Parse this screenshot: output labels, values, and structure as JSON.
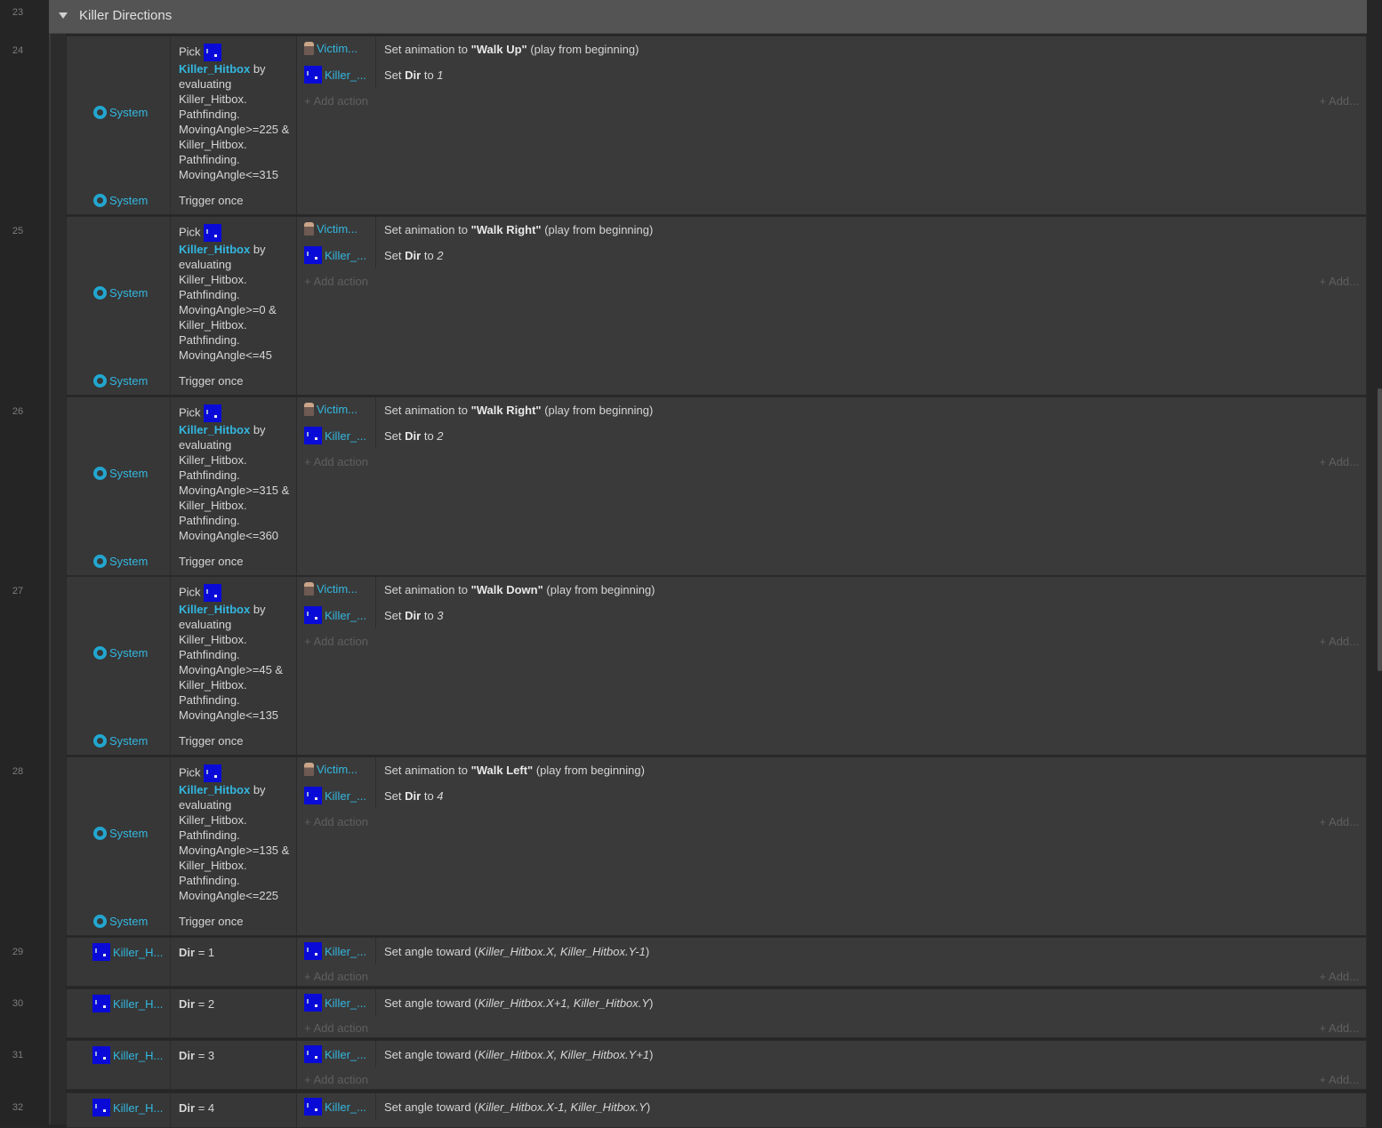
{
  "group": {
    "line": "23",
    "title": "Killer Directions"
  },
  "labels": {
    "system": "System",
    "pick": "Pick",
    "by": "by",
    "trigger_once": "Trigger once",
    "add_action": "+ Add action",
    "add_more": "+ Add...",
    "victim_short": "Victim...",
    "killer_short": "Killer_...",
    "killer_h": "Killer_H...",
    "hitbox": "Killer_Hitbox",
    "set_anim_pre": "Set animation to",
    "set_anim_post": "(play from beginning)",
    "set": "Set",
    "dir": "Dir",
    "to": "to",
    "set_angle_pre": "Set angle toward (",
    "set_angle_post": ")"
  },
  "events": [
    {
      "line": "24",
      "expr": "evaluating Killer_Hitbox. Pathfinding. MovingAngle>=225 & Killer_Hitbox. Pathfinding. MovingAngle<=315",
      "anim": "\"Walk Up\"",
      "dir_value": "1"
    },
    {
      "line": "25",
      "expr": "evaluating Killer_Hitbox. Pathfinding. MovingAngle>=0 & Killer_Hitbox. Pathfinding. MovingAngle<=45",
      "anim": "\"Walk Right\"",
      "dir_value": "2"
    },
    {
      "line": "26",
      "expr": "evaluating Killer_Hitbox. Pathfinding. MovingAngle>=315 & Killer_Hitbox. Pathfinding. MovingAngle<=360",
      "anim": "\"Walk Right\"",
      "dir_value": "2"
    },
    {
      "line": "27",
      "expr": "evaluating Killer_Hitbox. Pathfinding. MovingAngle>=45 & Killer_Hitbox. Pathfinding. MovingAngle<=135",
      "anim": "\"Walk Down\"",
      "dir_value": "3"
    },
    {
      "line": "28",
      "expr": "evaluating Killer_Hitbox. Pathfinding. MovingAngle>=135 & Killer_Hitbox. Pathfinding. MovingAngle<=225",
      "anim": "\"Walk Left\"",
      "dir_value": "4"
    }
  ],
  "dir_events": [
    {
      "line": "29",
      "cond": "= 1",
      "args": "Killer_Hitbox.X, Killer_Hitbox.Y-1"
    },
    {
      "line": "30",
      "cond": "= 2",
      "args": "Killer_Hitbox.X+1, Killer_Hitbox.Y"
    },
    {
      "line": "31",
      "cond": "= 3",
      "args": "Killer_Hitbox.X, Killer_Hitbox.Y+1"
    },
    {
      "line": "32",
      "cond": "= 4",
      "args": "Killer_Hitbox.X-1, Killer_Hitbox.Y"
    }
  ]
}
